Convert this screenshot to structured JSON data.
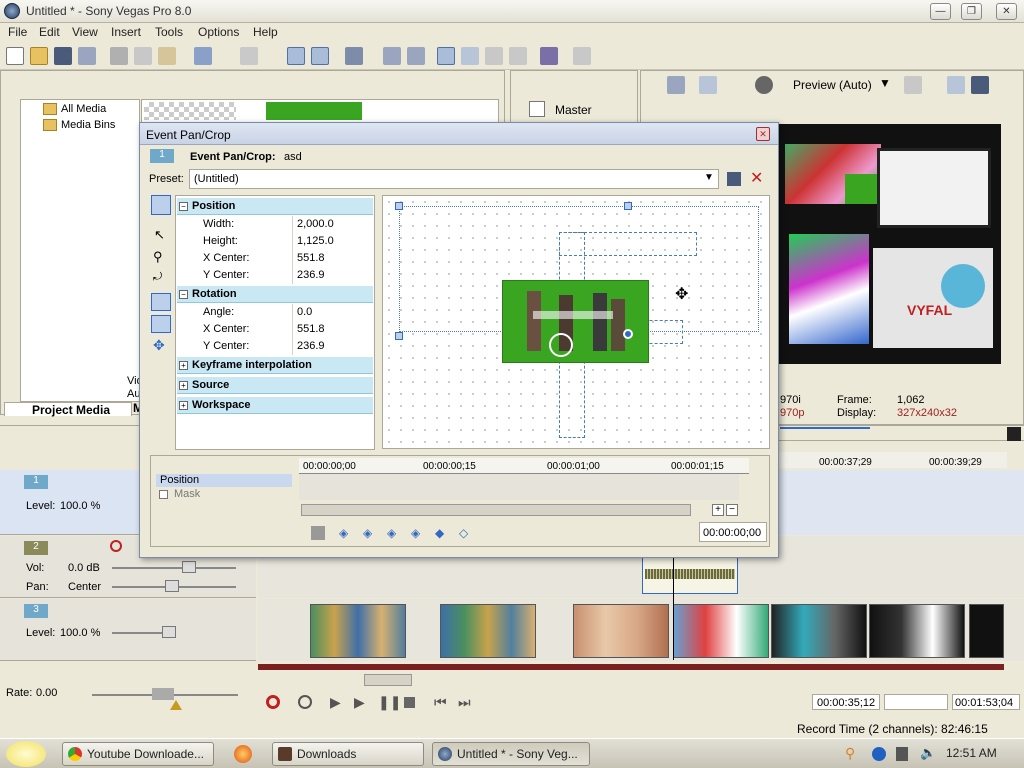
{
  "window": {
    "title": "Untitled * - Sony Vegas Pro 8.0"
  },
  "menu": [
    "File",
    "Edit",
    "View",
    "Insert",
    "Tools",
    "Options",
    "Help"
  ],
  "explorer": {
    "items": [
      "All Media",
      "Media Bins"
    ],
    "tabs": [
      "Project Media",
      "M"
    ],
    "partial_labels": [
      "Vid",
      "Au"
    ]
  },
  "mixer": {
    "master_label": "Master"
  },
  "preview": {
    "mode_label": "Preview (Auto)",
    "frame_label": "Frame:",
    "frame_value": "1,062",
    "display_label": "Display:",
    "display_value": "327x240x32",
    "rate_a": ".970i",
    "rate_b": ".970p"
  },
  "dialog": {
    "title": "Event Pan/Crop",
    "event_label": "Event Pan/Crop:",
    "event_name": "asd",
    "event_index": "1",
    "preset_label": "Preset:",
    "preset_value": "(Untitled)",
    "sections": {
      "position": "Position",
      "rotation": "Rotation",
      "keyframe": "Keyframe interpolation",
      "source": "Source",
      "workspace": "Workspace"
    },
    "position": [
      {
        "key": "Width:",
        "value": "2,000.0"
      },
      {
        "key": "Height:",
        "value": "1,125.0"
      },
      {
        "key": "X Center:",
        "value": "551.8"
      },
      {
        "key": "Y Center:",
        "value": "236.9"
      }
    ],
    "rotation": [
      {
        "key": "Angle:",
        "value": "0.0"
      },
      {
        "key": "X Center:",
        "value": "551.8"
      },
      {
        "key": "Y Center:",
        "value": "236.9"
      }
    ],
    "keyframe_tracks": [
      "Position",
      "Mask"
    ],
    "ruler": [
      "00:00:00;00",
      "00:00:00;15",
      "00:00:01;00",
      "00:00:01;15"
    ],
    "time_value": "00:00:00;00"
  },
  "timeline": {
    "ruler": [
      "00:00:37;29",
      "00:00:39;29"
    ],
    "tracks": [
      {
        "number": "1",
        "level_label": "Level:",
        "level_value": "100.0 %"
      },
      {
        "number": "2",
        "vol_label": "Vol:",
        "vol_value": "0.0 dB",
        "pan_label": "Pan:",
        "pan_value": "Center"
      },
      {
        "number": "3",
        "level_label": "Level:",
        "level_value": "100.0 %"
      }
    ],
    "rate_label": "Rate:",
    "rate_value": "0.00",
    "time_current": "00:00:35;12",
    "time_end": "00:01:53;04",
    "record_time": "Record Time (2 channels): 82:46:15"
  },
  "taskbar": {
    "buttons": [
      "Youtube Downloade...",
      "Downloads",
      "Untitled * - Sony Veg..."
    ],
    "clock": "12:51 AM"
  },
  "colors": {
    "chroma_green": "#3aa521",
    "accent_blue": "#316ac5",
    "section_header": "#c9e8f4"
  }
}
